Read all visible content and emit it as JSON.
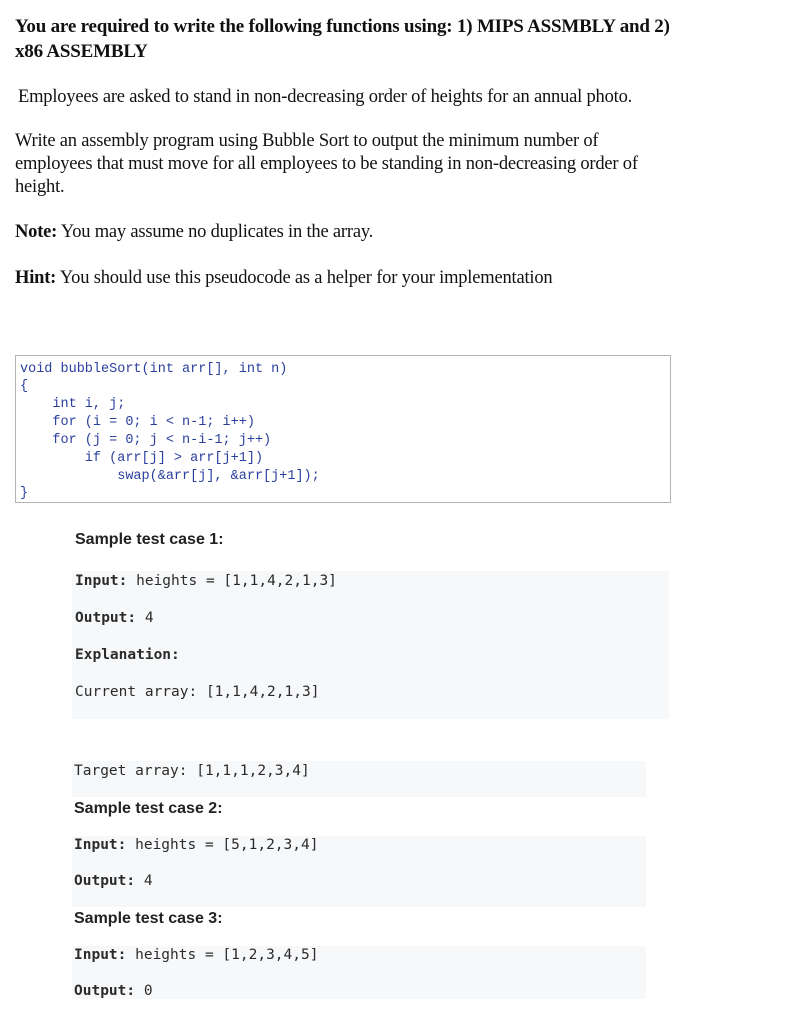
{
  "title": {
    "line1": "You are required to write the following functions using: 1) MIPS ASSMBLY and 2)",
    "line2": "x86 ASSEMBLY"
  },
  "intro": "Employees are asked to stand in non-decreasing order of heights for an annual photo.",
  "task": {
    "line1": "Write an assembly program using Bubble Sort to output the minimum number of",
    "line2": "employees that must move for all employees to be standing in non-decreasing order of",
    "line3": "height."
  },
  "note": {
    "label": "Note:",
    "text": " You may assume no duplicates in the array."
  },
  "hint": {
    "label": "Hint:",
    "text": " You should use this pseudocode as a helper for your implementation"
  },
  "code": {
    "lines": [
      "void bubbleSort(int arr[], int n)",
      "{",
      "    int i, j;",
      "    for (i = 0; i < n-1; i++)",
      "    for (j = 0; j < n-i-1; j++)",
      "        if (arr[j] > arr[j+1])",
      "            swap(&arr[j], &arr[j+1]);",
      "}"
    ]
  },
  "test_cases": [
    {
      "heading": "Sample test case 1:",
      "input_label": "Input:",
      "input_value": " heights = [1,1,4,2,1,3]",
      "output_label": "Output:",
      "output_value": " 4",
      "explanation_label": "Explanation:",
      "current_array": "Current array: [1,1,4,2,1,3]",
      "target_array": "Target array: [1,1,1,2,3,4]"
    },
    {
      "heading": "Sample test case 2:",
      "input_label": "Input:",
      "input_value": " heights = [5,1,2,3,4]",
      "output_label": "Output:",
      "output_value": " 4"
    },
    {
      "heading": "Sample test case 3:",
      "input_label": "Input:",
      "input_value": " heights = [1,2,3,4,5]",
      "output_label": "Output:",
      "output_value": " 0"
    }
  ]
}
